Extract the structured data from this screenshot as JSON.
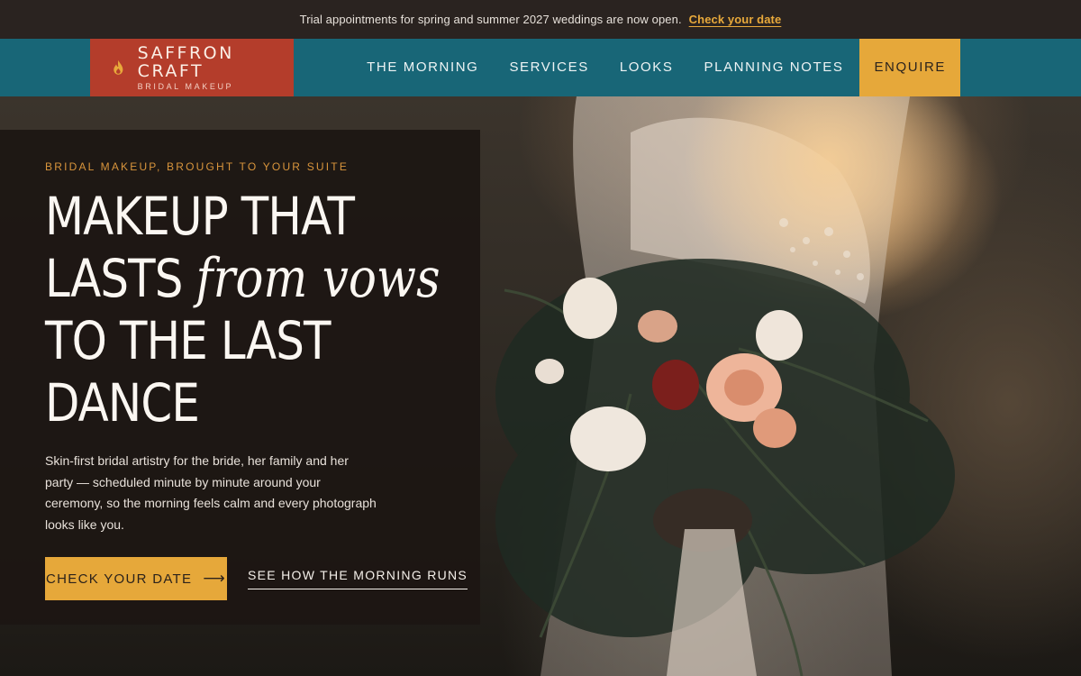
{
  "announcement": {
    "text": "Trial appointments for spring and summer 2027 weddings are now open.",
    "link_label": "Check your date"
  },
  "brand": {
    "name": "SAFFRON CRAFT",
    "tagline": "BRIDAL MAKEUP",
    "icon": "flame-icon"
  },
  "nav": {
    "items": [
      {
        "label": "THE MORNING"
      },
      {
        "label": "SERVICES"
      },
      {
        "label": "LOOKS"
      },
      {
        "label": "PLANNING NOTES"
      }
    ],
    "cta_label": "ENQUIRE"
  },
  "hero": {
    "eyebrow": "BRIDAL MAKEUP, BROUGHT TO YOUR SUITE",
    "headline": {
      "line1": "MAKEUP THAT",
      "line2_pre": "LASTS ",
      "line2_accent": "from vows",
      "line3": "TO THE LAST",
      "line4": "DANCE"
    },
    "lede": "Skin-first bridal artistry for the bride, her family and her party — scheduled minute by minute around your ceremony, so the morning feels calm and every photograph looks like you.",
    "primary_cta": "CHECK YOUR DATE",
    "primary_cta_icon": "arrow-right-icon",
    "secondary_cta": "SEE HOW THE MORNING RUNS"
  },
  "colors": {
    "announcement_bg": "#2a2320",
    "nav_bg": "#186677",
    "brand_bg": "#b43d2b",
    "accent": "#e6a83a",
    "panel_bg": "#1d1613"
  }
}
